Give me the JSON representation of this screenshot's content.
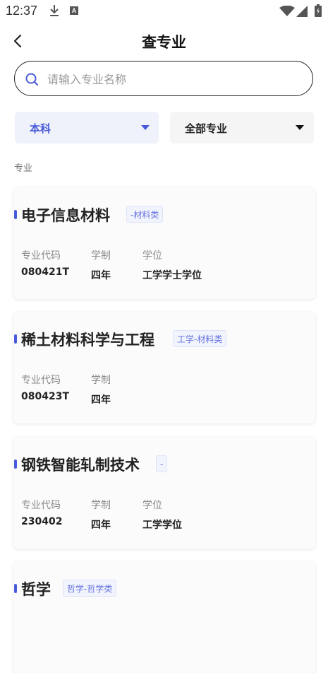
{
  "status_bar": {
    "time": "12:37",
    "a_badge": "A"
  },
  "header": {
    "title": "查专业"
  },
  "search": {
    "placeholder": "请输入专业名称"
  },
  "filters": {
    "level": "本科",
    "category": "全部专业"
  },
  "section_label": "专业",
  "columns": {
    "code": "专业代码",
    "duration": "学制",
    "degree": "学位"
  },
  "majors": [
    {
      "name": "电子信息材料",
      "tag": "-材料类",
      "code": "080421T",
      "duration": "四年",
      "degree": "工学学士学位"
    },
    {
      "name": "稀土材料科学与工程",
      "tag": "工学-材料类",
      "code": "080423T",
      "duration": "四年",
      "degree": ""
    },
    {
      "name": "钢铁智能轧制技术",
      "tag": "-",
      "code": "230402",
      "duration": "四年",
      "degree": "工学学位"
    },
    {
      "name": "哲学",
      "tag": "哲学-哲学类"
    }
  ],
  "colors": {
    "accent": "#4a5bd9",
    "filter_active_bg": "#eff1fb",
    "tag_text": "#6573de"
  },
  "icons": {
    "back": "chevron-left-icon",
    "search": "search-icon",
    "download": "download-icon",
    "wifi": "wifi-icon",
    "signal": "signal-icon",
    "battery": "battery-icon"
  }
}
